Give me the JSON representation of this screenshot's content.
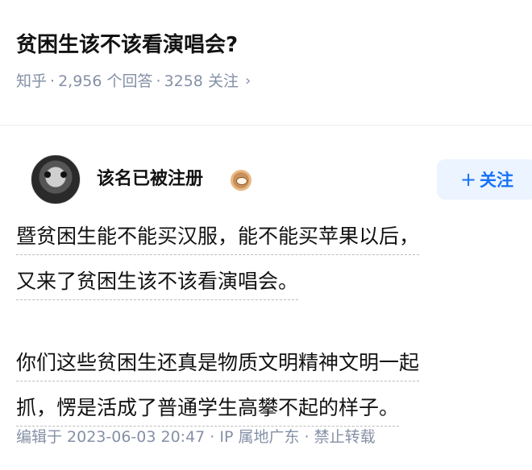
{
  "question": {
    "title": "贫困生该不该看演唱会?",
    "source": "知乎",
    "answers": "2,956 个回答",
    "followers": "3258 关注",
    "chevron": "›",
    "sep": "·"
  },
  "author": {
    "name": "该名已被注册",
    "badge_icon": "eye-badge-icon",
    "follow_plus": "+",
    "follow_label": "关注"
  },
  "answer": {
    "paragraphs": [
      {
        "lines": [
          "暨贫困生能不能买汉服，能不能买苹果以后，",
          "又来了贫困生该不该看演唱会。"
        ]
      },
      {
        "lines": [
          "你们这些贫困生还真是物质文明精神文明一起",
          "抓，愣是活成了普通学生高攀不起的样子。"
        ]
      }
    ],
    "meta": "编辑于 2023-06-03 20:47 · IP 属地广东 · 禁止转载"
  },
  "colors": {
    "accent": "#1772f6",
    "follow_bg": "#ebf4ff",
    "meta_text": "#8590a6",
    "badge": "#c8905a"
  }
}
